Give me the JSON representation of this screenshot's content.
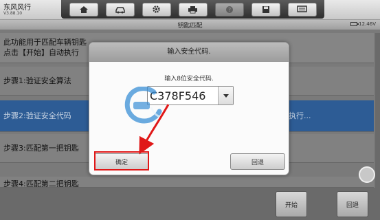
{
  "app": {
    "title": "东风风行",
    "version": "V3.88.10"
  },
  "toolbar": {
    "icons": [
      "home-icon",
      "car-icon",
      "gear-icon",
      "printer-icon",
      "help-icon",
      "save-icon",
      "message-icon"
    ]
  },
  "subheader": {
    "title": "钥匙匹配",
    "battery": "12.46V"
  },
  "content": {
    "intro_line1": "此功能用于匹配车辆钥匙",
    "intro_line2": "点击【开始】自动执行",
    "step1": "步骤1:验证安全算法",
    "step2": "步骤2:验证安全代码",
    "step2_tail": "执行...",
    "step3": "步骤3:匹配第一把钥匙",
    "step4": "步骤4:匹配第二把钥匙"
  },
  "footer": {
    "start_label": "开始",
    "back_label": "回退"
  },
  "dialog": {
    "title": "输入安全代码.",
    "prompt": "输入8位安全代码.",
    "code_value": "C378F546",
    "ok_label": "确定",
    "cancel_label": "回退"
  },
  "colors": {
    "selected_row": "#2d5c95",
    "highlight": "#e01818"
  }
}
